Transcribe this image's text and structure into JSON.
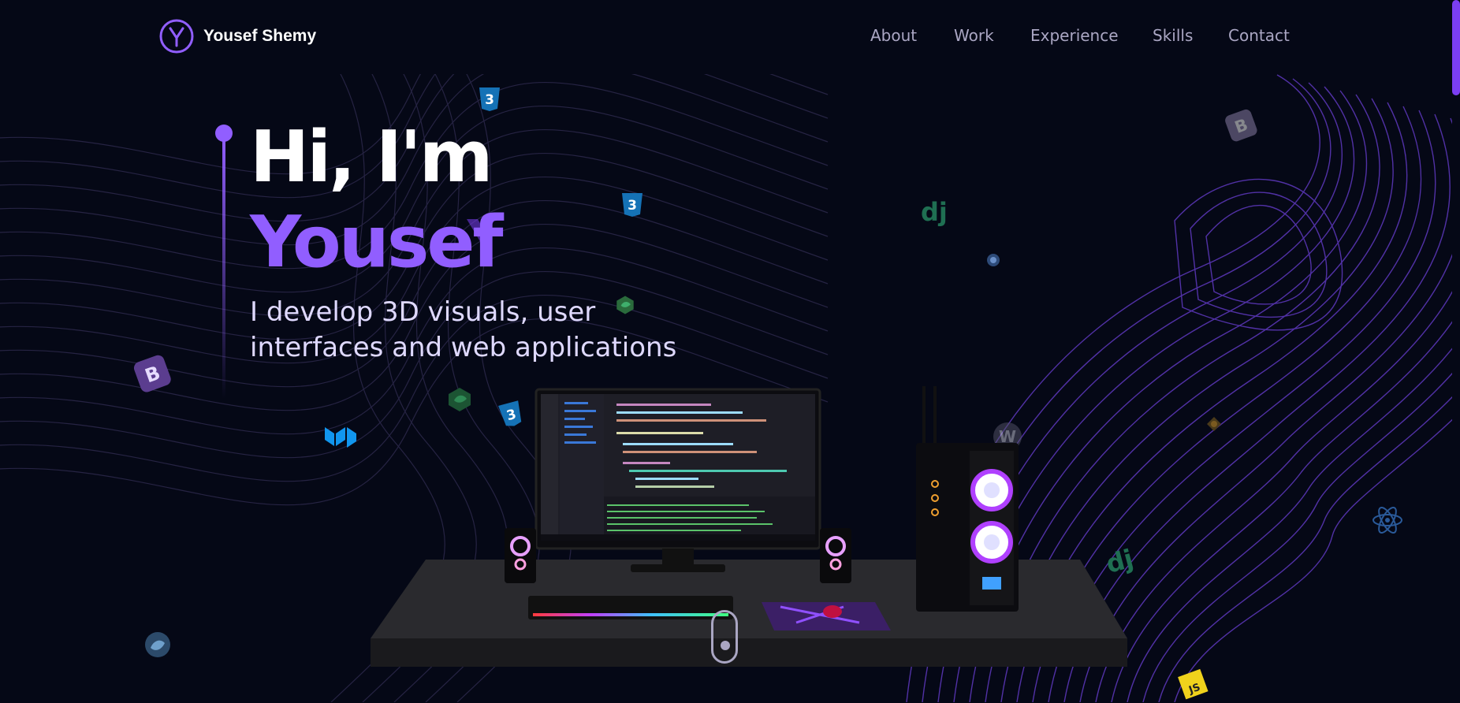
{
  "brand": {
    "name": "Yousef  Shemy",
    "logo_letter": "Y",
    "accent": "#915eff"
  },
  "nav": {
    "items": [
      "About",
      "Work",
      "Experience",
      "Skills",
      "Contact"
    ]
  },
  "hero": {
    "greeting": "Hi, I'm",
    "name": "Yousef",
    "subtitle_line1": "I develop 3D visuals, user",
    "subtitle_line2": "interfaces and web applications"
  },
  "floating_icons": [
    "css3-icon",
    "css3-icon",
    "css3-icon",
    "bootstrap-icon",
    "django-icon",
    "django-icon",
    "javascript-icon",
    "mui-icon",
    "vue-icon",
    "nodejs-icon",
    "react-icon",
    "redux-icon",
    "figma-icon",
    "threejs-icon"
  ],
  "colors": {
    "background": "#050816",
    "accent": "#915eff",
    "nav_text": "#aaa6c3",
    "subtitle": "#dfd9ff"
  },
  "icon_labels": {
    "css": "3",
    "bootstrap": "B",
    "django": "dj",
    "js": "JS"
  }
}
